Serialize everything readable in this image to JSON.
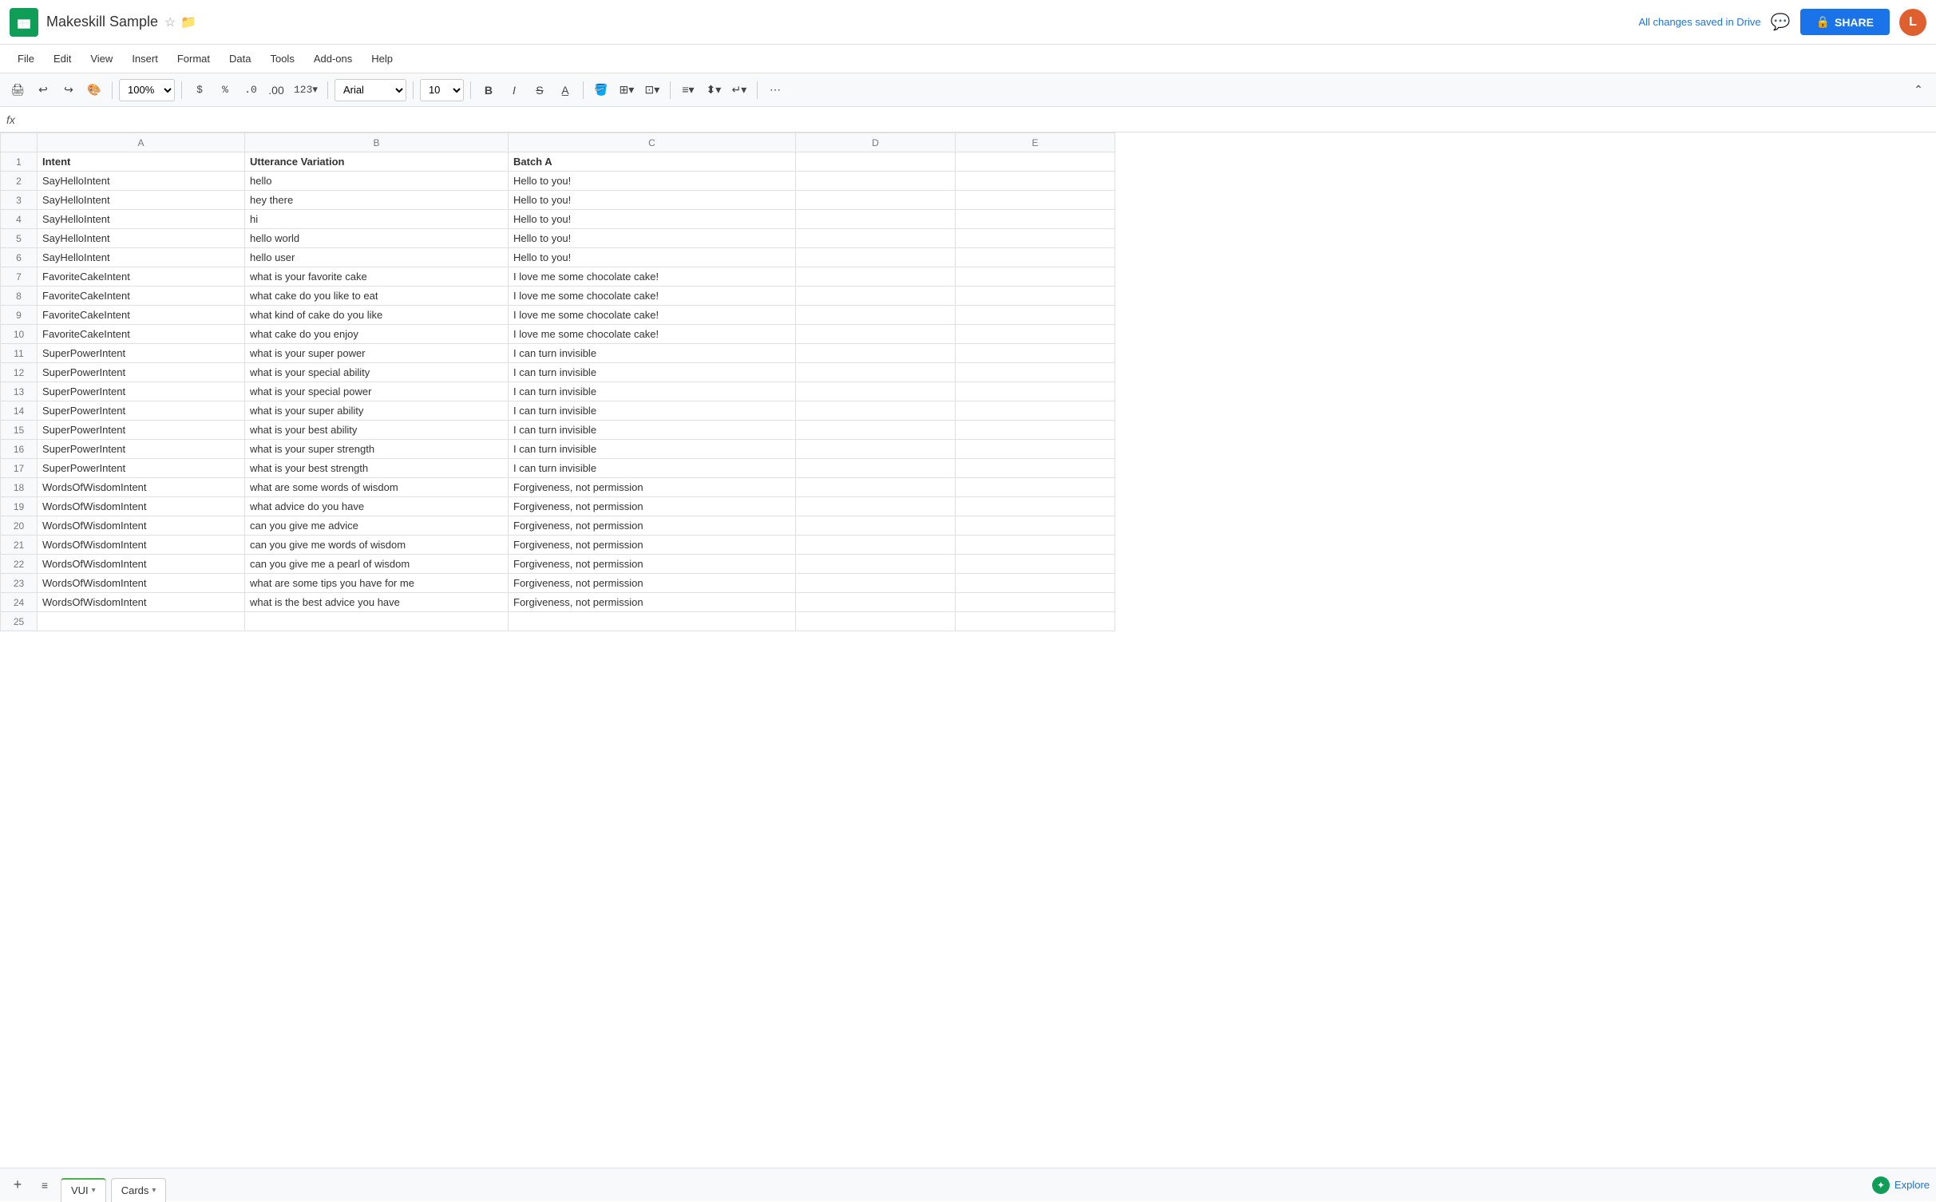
{
  "app": {
    "logo_color": "#0f9d58",
    "title": "Makeskill Sample",
    "user_initial": "L"
  },
  "titlebar": {
    "doc_title": "Makeskill Sample",
    "share_label": "SHARE",
    "saved_status": "All changes saved in Drive"
  },
  "menu": {
    "items": [
      "File",
      "Edit",
      "View",
      "Insert",
      "Format",
      "Data",
      "Tools",
      "Add-ons",
      "Help"
    ]
  },
  "toolbar": {
    "zoom": "100%",
    "font": "Arial",
    "font_size": "10",
    "currency": "$",
    "percent": "%",
    "decimal_dec": ".0",
    "decimal_inc": ".00",
    "format_num": "123"
  },
  "formula_bar": {
    "fx": "fx"
  },
  "columns": {
    "headers": [
      "",
      "A",
      "B",
      "C",
      "D",
      "E"
    ],
    "col_labels": [
      "Intent",
      "Utterance Variation",
      "Batch A",
      "",
      ""
    ]
  },
  "rows": [
    {
      "num": 1,
      "a": "Intent",
      "b": "Utterance Variation",
      "c": "Batch A",
      "d": "",
      "e": ""
    },
    {
      "num": 2,
      "a": "SayHelloIntent",
      "b": "hello",
      "c": "Hello to you!",
      "d": "",
      "e": ""
    },
    {
      "num": 3,
      "a": "SayHelloIntent",
      "b": "hey there",
      "c": "Hello to you!",
      "d": "",
      "e": ""
    },
    {
      "num": 4,
      "a": "SayHelloIntent",
      "b": "hi",
      "c": "Hello to you!",
      "d": "",
      "e": ""
    },
    {
      "num": 5,
      "a": "SayHelloIntent",
      "b": "hello world",
      "c": "Hello to you!",
      "d": "",
      "e": ""
    },
    {
      "num": 6,
      "a": "SayHelloIntent",
      "b": "hello user",
      "c": "Hello to you!",
      "d": "",
      "e": ""
    },
    {
      "num": 7,
      "a": "FavoriteCakeIntent",
      "b": "what is your favorite cake",
      "c": "I love me some chocolate cake!",
      "d": "",
      "e": ""
    },
    {
      "num": 8,
      "a": "FavoriteCakeIntent",
      "b": "what cake do you like to eat",
      "c": "I love me some chocolate cake!",
      "d": "",
      "e": ""
    },
    {
      "num": 9,
      "a": "FavoriteCakeIntent",
      "b": "what kind of cake do you like",
      "c": "I love me some chocolate cake!",
      "d": "",
      "e": ""
    },
    {
      "num": 10,
      "a": "FavoriteCakeIntent",
      "b": "what cake do you enjoy",
      "c": "I love me some chocolate cake!",
      "d": "",
      "e": ""
    },
    {
      "num": 11,
      "a": "SuperPowerIntent",
      "b": "what is your super power",
      "c": "I can turn invisible",
      "d": "",
      "e": ""
    },
    {
      "num": 12,
      "a": "SuperPowerIntent",
      "b": "what is your special ability",
      "c": "I can turn invisible",
      "d": "",
      "e": ""
    },
    {
      "num": 13,
      "a": "SuperPowerIntent",
      "b": "what is your special power",
      "c": "I can turn invisible",
      "d": "",
      "e": ""
    },
    {
      "num": 14,
      "a": "SuperPowerIntent",
      "b": "what is your super ability",
      "c": "I can turn invisible",
      "d": "",
      "e": ""
    },
    {
      "num": 15,
      "a": "SuperPowerIntent",
      "b": "what is your best ability",
      "c": "I can turn invisible",
      "d": "",
      "e": ""
    },
    {
      "num": 16,
      "a": "SuperPowerIntent",
      "b": "what is your super strength",
      "c": "I can turn invisible",
      "d": "",
      "e": ""
    },
    {
      "num": 17,
      "a": "SuperPowerIntent",
      "b": "what is your best strength",
      "c": "I can turn invisible",
      "d": "",
      "e": ""
    },
    {
      "num": 18,
      "a": "WordsOfWisdomIntent",
      "b": "what are some words of wisdom",
      "c": "Forgiveness, not permission",
      "d": "",
      "e": ""
    },
    {
      "num": 19,
      "a": "WordsOfWisdomIntent",
      "b": "what advice do you have",
      "c": "Forgiveness, not permission",
      "d": "",
      "e": ""
    },
    {
      "num": 20,
      "a": "WordsOfWisdomIntent",
      "b": "can you give me advice",
      "c": "Forgiveness, not permission",
      "d": "",
      "e": ""
    },
    {
      "num": 21,
      "a": "WordsOfWisdomIntent",
      "b": "can you give me words of wisdom",
      "c": "Forgiveness, not permission",
      "d": "",
      "e": ""
    },
    {
      "num": 22,
      "a": "WordsOfWisdomIntent",
      "b": "can you give me a pearl of wisdom",
      "c": "Forgiveness, not permission",
      "d": "",
      "e": ""
    },
    {
      "num": 23,
      "a": "WordsOfWisdomIntent",
      "b": "what are some tips you have for me",
      "c": "Forgiveness, not permission",
      "d": "",
      "e": ""
    },
    {
      "num": 24,
      "a": "WordsOfWisdomIntent",
      "b": "what is the best advice you have",
      "c": "Forgiveness, not permission",
      "d": "",
      "e": ""
    },
    {
      "num": 25,
      "a": "",
      "b": "",
      "c": "",
      "d": "",
      "e": ""
    }
  ],
  "sheets": [
    {
      "name": "VUI",
      "active": true
    },
    {
      "name": "Cards",
      "active": false
    }
  ],
  "bottom": {
    "explore_label": "Explore"
  }
}
